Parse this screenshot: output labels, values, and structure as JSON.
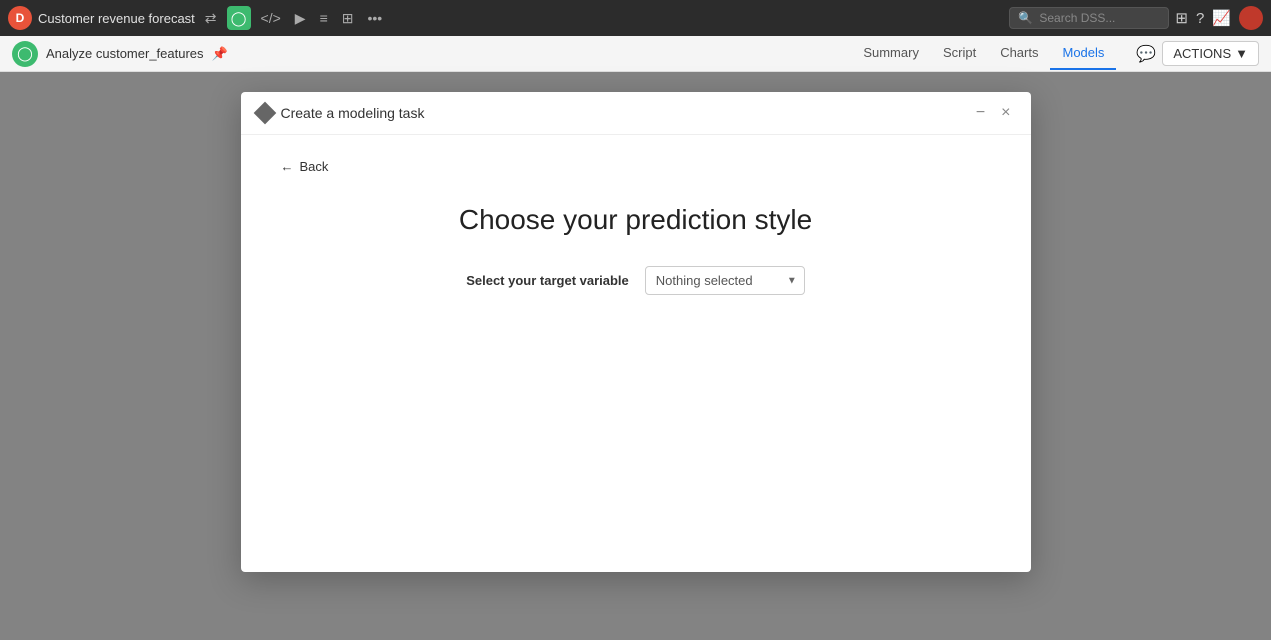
{
  "app": {
    "title": "Customer revenue forecast",
    "logo_letter": "D"
  },
  "topbar": {
    "search_placeholder": "Search DSS...",
    "icons": [
      "⇄",
      "◯",
      "</>",
      "▶",
      "≡",
      "⊞",
      "•••"
    ]
  },
  "secondbar": {
    "title": "Analyze customer_features",
    "logo_letter": "◯",
    "nav_items": [
      {
        "label": "Summary",
        "active": false
      },
      {
        "label": "Script",
        "active": false
      },
      {
        "label": "Charts",
        "active": false
      },
      {
        "label": "Models",
        "active": true
      }
    ],
    "actions_label": "ACTIONS"
  },
  "modal": {
    "title": "Create a modeling task",
    "back_label": "Back",
    "main_title": "Choose your prediction style",
    "target_variable_label": "Select your target variable",
    "target_variable_placeholder": "Nothing selected",
    "minimize_label": "−",
    "close_label": "×"
  }
}
